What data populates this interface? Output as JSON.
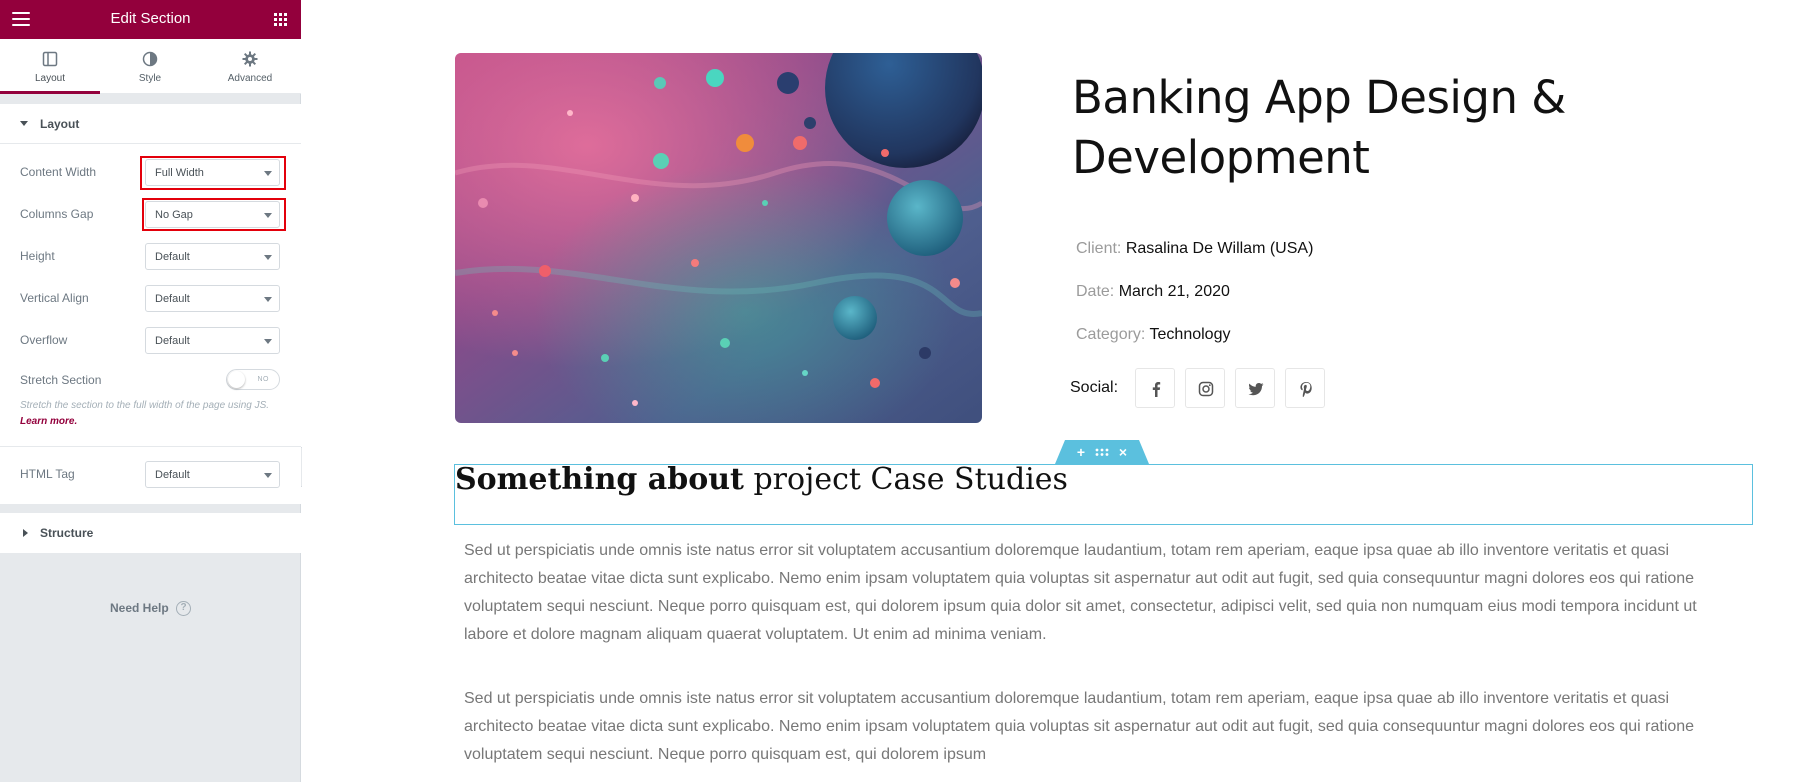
{
  "sidebar": {
    "header_title": "Edit Section",
    "tabs": [
      {
        "label": "Layout",
        "icon": "layout-icon",
        "active": true
      },
      {
        "label": "Style",
        "icon": "contrast-icon",
        "active": false
      },
      {
        "label": "Advanced",
        "icon": "gear-icon",
        "active": false
      }
    ],
    "layout_section": {
      "title": "Layout",
      "controls": {
        "content_width": {
          "label": "Content Width",
          "value": "Full Width"
        },
        "columns_gap": {
          "label": "Columns Gap",
          "value": "No Gap"
        },
        "height": {
          "label": "Height",
          "value": "Default"
        },
        "vertical_align": {
          "label": "Vertical Align",
          "value": "Default"
        },
        "overflow": {
          "label": "Overflow",
          "value": "Default"
        },
        "stretch_section": {
          "label": "Stretch Section",
          "toggle_text": "NO",
          "checked": false
        },
        "html_tag": {
          "label": "HTML Tag",
          "value": "Default"
        }
      },
      "stretch_description": "Stretch the section to the full width of the page using JS.",
      "learn_more": "Learn more."
    },
    "structure_section": {
      "title": "Structure"
    },
    "need_help": "Need Help",
    "help_icon_glyph": "?"
  },
  "main": {
    "project_title": "Banking App Design & Development",
    "meta": [
      {
        "key": "Client:",
        "value": "Rasalina De Willam (USA)"
      },
      {
        "key": "Date:",
        "value": "March 21, 2020"
      },
      {
        "key": "Category:",
        "value": "Technology"
      }
    ],
    "social_label": "Social:",
    "social_icons": [
      "facebook-icon",
      "instagram-icon",
      "twitter-icon",
      "pinterest-icon"
    ],
    "section_heading_bold": "Something about",
    "section_heading_rest": " project Case Studies",
    "paragraph_1": "Sed ut perspiciatis unde omnis iste natus error sit voluptatem accusantium doloremque laudantium, totam rem aperiam, eaque ipsa quae ab illo inventore veritatis et quasi architecto beatae vitae dicta sunt explicabo. Nemo enim ipsam voluptatem quia voluptas sit aspernatur aut odit aut fugit, sed quia consequuntur magni dolores eos qui ratione voluptatem sequi nesciunt. Neque porro quisquam est, qui dolorem ipsum quia dolor sit amet, consectetur, adipisci velit, sed quia non numquam eius modi tempora incidunt ut labore et dolore magnam aliquam quaerat voluptatem. Ut enim ad minima veniam.",
    "paragraph_2": "Sed ut perspiciatis unde omnis iste natus error sit voluptatem accusantium doloremque laudantium, totam rem aperiam, eaque ipsa quae ab illo inventore veritatis et quasi architecto beatae vitae dicta sunt explicabo. Nemo enim ipsam voluptatem quia voluptas sit aspernatur aut odit aut fugit, sed quia consequuntur magni dolores eos qui ratione voluptatem sequi nesciunt. Neque porro quisquam est, qui dolorem ipsum",
    "section_tools": {
      "add": "+",
      "close": "×"
    }
  },
  "colors": {
    "brand": "#93003c",
    "highlight": "#e3000b",
    "selection": "#5bc0de",
    "panel_bg": "#e6e9ec"
  }
}
